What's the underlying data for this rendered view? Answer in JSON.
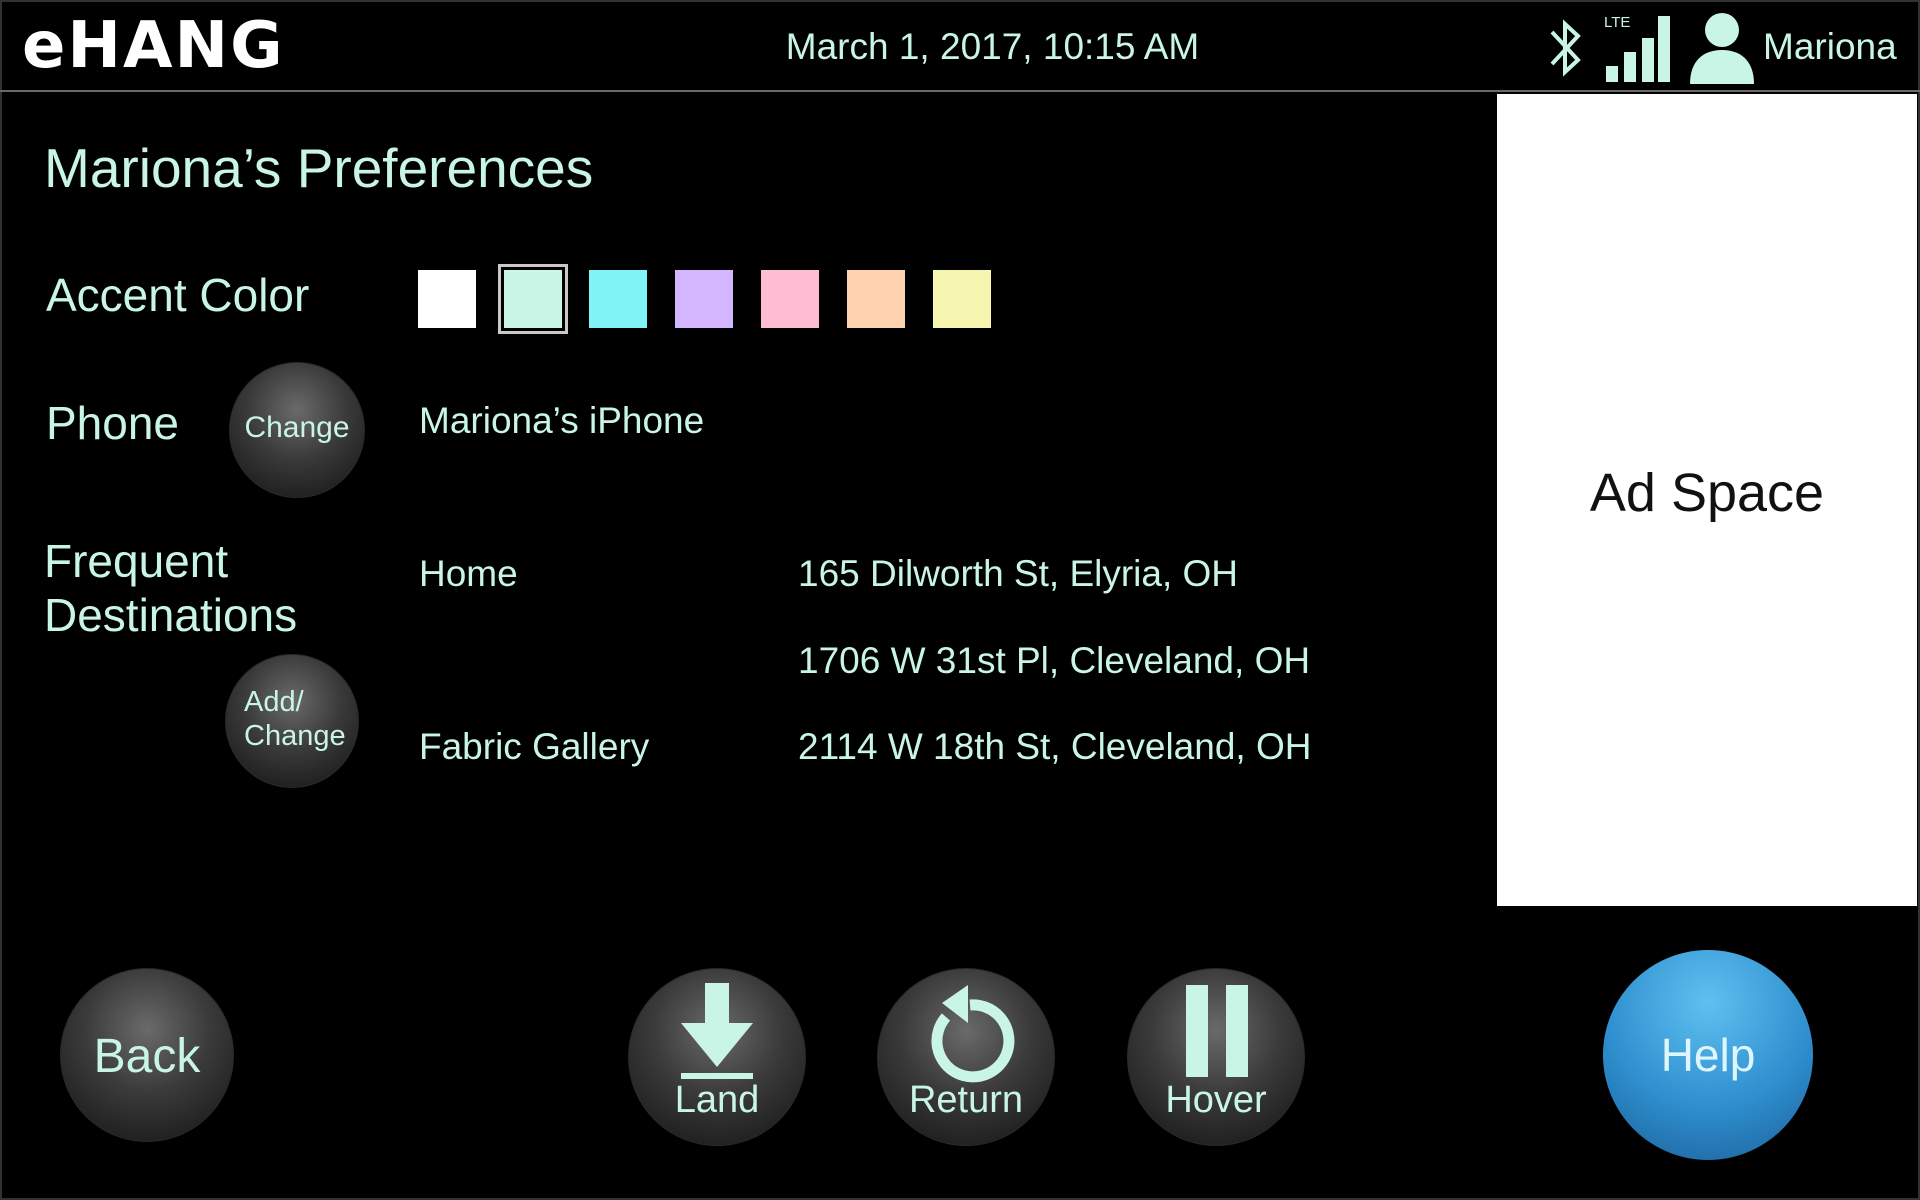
{
  "header": {
    "logo_text": "eHANG",
    "datetime": "March 1, 2017, 10:15 AM",
    "network_label": "LTE",
    "username": "Mariona"
  },
  "title": "Mariona’s Preferences",
  "accent": {
    "label": "Accent Color",
    "swatches": [
      "#ffffff",
      "#c8f5e6",
      "#7ff3f6",
      "#d4b5ff",
      "#ffbdd3",
      "#ffd3b0",
      "#f6f6b0"
    ],
    "selected_index": 1
  },
  "phone": {
    "label": "Phone",
    "change_label": "Change",
    "device_name": "Mariona’s iPhone"
  },
  "frequent": {
    "label_line1": "Frequent",
    "label_line2": "Destinations",
    "add_change_line1": "Add/",
    "add_change_line2": "Change",
    "destinations": [
      {
        "name": "Home",
        "address": "165 Dilworth St, Elyria, OH"
      },
      {
        "name": "",
        "address": "1706 W 31st Pl, Cleveland, OH"
      },
      {
        "name": "Fabric Gallery",
        "address": "2114 W 18th St, Cleveland, OH"
      }
    ]
  },
  "ad": {
    "text": "Ad Space"
  },
  "controls": {
    "back": "Back",
    "land": "Land",
    "return": "Return",
    "hover": "Hover",
    "help": "Help"
  },
  "icons": {
    "bluetooth": "bluetooth-icon",
    "signal": "signal-icon",
    "user": "user-icon",
    "land": "arrow-down-icon",
    "return": "return-icon",
    "hover": "pause-icon"
  }
}
